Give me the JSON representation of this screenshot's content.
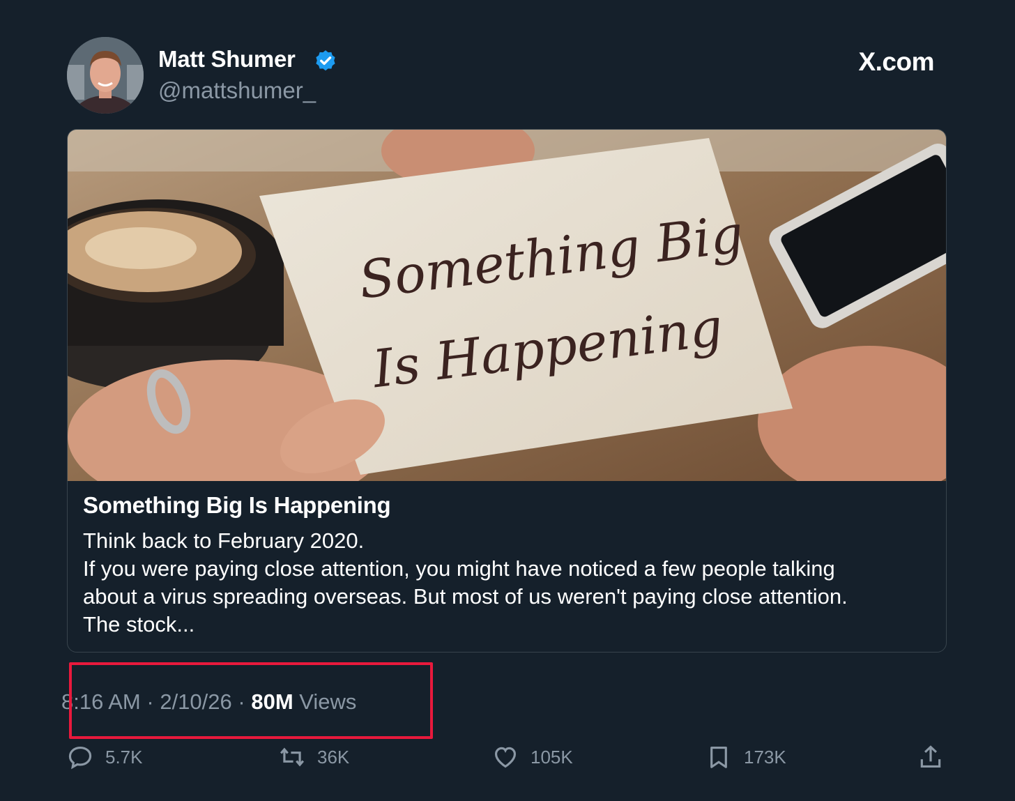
{
  "author": {
    "name": "Matt Shumer",
    "handle": "@mattshumer_",
    "verified_color": "#1d9bf0"
  },
  "brand": "X.com",
  "card": {
    "image_text_line1": "Something Big",
    "image_text_line2": "Is Happening",
    "title": "Something Big Is Happening",
    "description_lines": [
      "Think back to February 2020.",
      "If you were paying close attention, you might have noticed a few people talking",
      "about a virus spreading overseas. But most of us weren't paying close attention.",
      "The stock..."
    ]
  },
  "meta": {
    "time": "8:16 AM",
    "separator": "·",
    "date": "2/10/26",
    "views_count": "80M",
    "views_label": "Views"
  },
  "actions": {
    "replies": "5.7K",
    "reposts": "36K",
    "likes": "105K",
    "bookmarks": "173K"
  },
  "colors": {
    "background": "#15202b",
    "highlight": "#e8193c",
    "secondary_text": "#8b98a5"
  }
}
